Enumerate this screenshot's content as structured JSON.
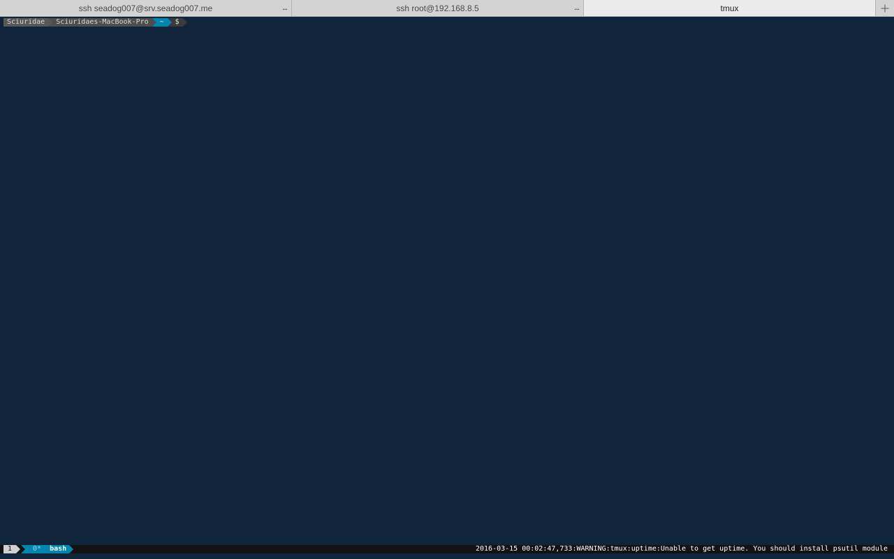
{
  "tabs": [
    {
      "title": "ssh seadog007@srv.seadog007.me",
      "menu": "...",
      "active": false
    },
    {
      "title": "ssh root@192.168.8.5",
      "menu": "...",
      "active": false
    },
    {
      "title": "tmux",
      "menu": "",
      "active": true
    }
  ],
  "new_tab_icon": "plus-icon",
  "prompt": {
    "user": "Sciuridae",
    "host": "Sciuridaes-MacBook-Pro",
    "dir": "~",
    "symbol": "$"
  },
  "tmux": {
    "session": "1",
    "window_index": "0*",
    "window_name": "bash",
    "status_right": "2016-03-15 00:02:47,733:WARNING:tmux:uptime:Unable to get uptime. You should install psutil module"
  },
  "colors": {
    "terminal_bg": "#10243a",
    "accent": "#0087af",
    "tab_bar": "#d4d4d4"
  }
}
